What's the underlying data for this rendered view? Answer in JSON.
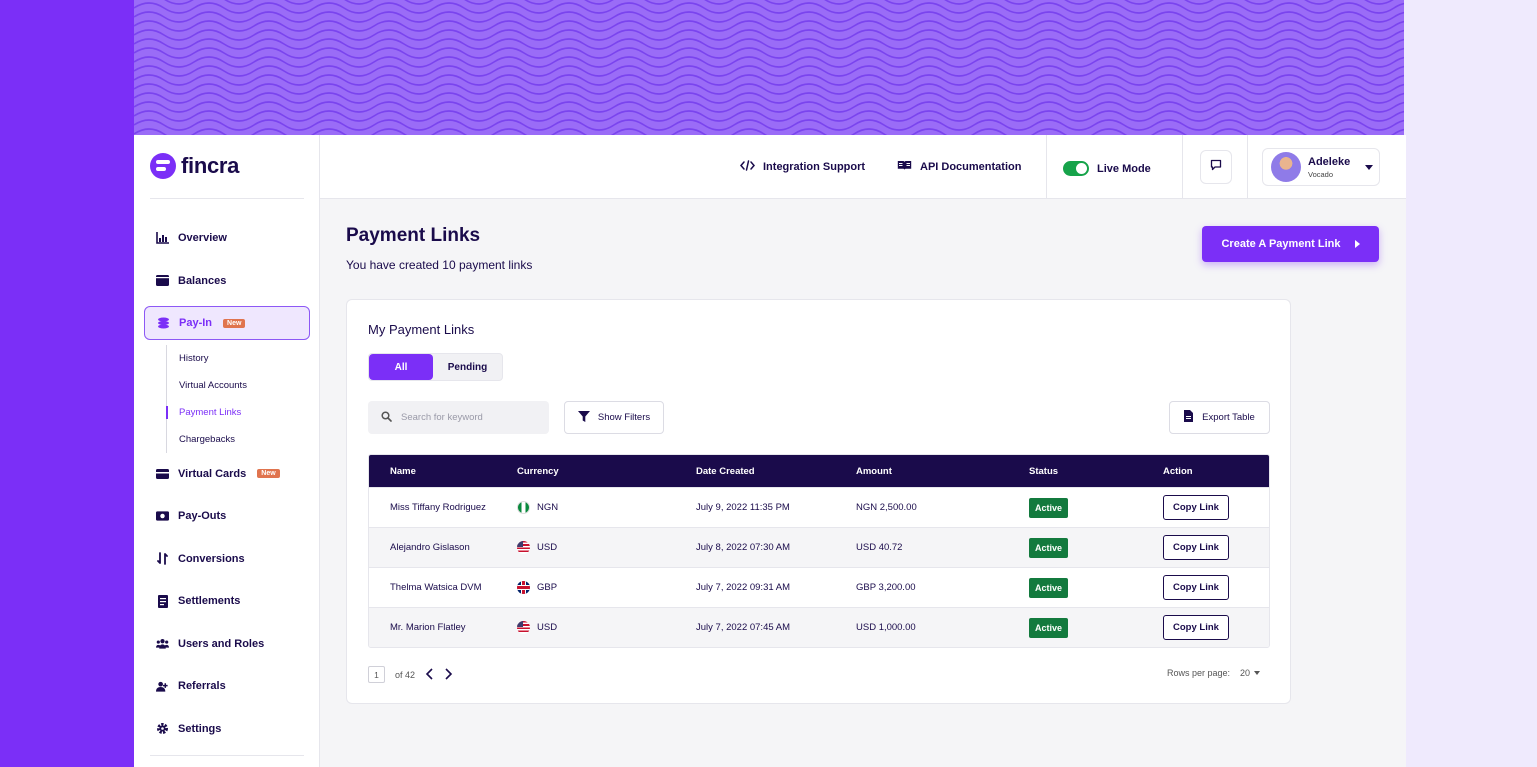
{
  "brand": {
    "name": "fincra",
    "accent": "#7b2ff7",
    "dark": "#1a0b4b",
    "success": "#137a3e",
    "badge": "#e0744e"
  },
  "sidebar": {
    "items": [
      {
        "label": "Overview",
        "icon": "chart-icon"
      },
      {
        "label": "Balances",
        "icon": "wallet-icon"
      },
      {
        "label": "Pay-In",
        "icon": "coins-icon",
        "badge": "New",
        "active": true
      },
      {
        "label": "Virtual Cards",
        "icon": "card-icon",
        "badge": "New"
      },
      {
        "label": "Pay-Outs",
        "icon": "money-icon"
      },
      {
        "label": "Conversions",
        "icon": "exchange-icon"
      },
      {
        "label": "Settlements",
        "icon": "receipt-icon"
      },
      {
        "label": "Users and Roles",
        "icon": "users-icon"
      },
      {
        "label": "Referrals",
        "icon": "referral-icon"
      },
      {
        "label": "Settings",
        "icon": "gear-icon"
      }
    ],
    "payin_sub": [
      "History",
      "Virtual Accounts",
      "Payment Links",
      "Chargebacks"
    ],
    "payin_sub_active": "Payment Links"
  },
  "header": {
    "integration_support": "Integration Support",
    "api_documentation": "API Documentation",
    "live_mode": "Live Mode",
    "user_name": "Adeleke",
    "user_company": "Vocado"
  },
  "main": {
    "title": "Payment Links",
    "subtitle": "You have created 10 payment links",
    "create_button": "Create A Payment Link",
    "card_title": "My Payment Links",
    "tabs": [
      "All",
      "Pending"
    ],
    "search_placeholder": "Search for keyword",
    "show_filters": "Show Filters",
    "export_table": "Export Table",
    "columns": [
      "Name",
      "Currency",
      "Date Created",
      "Amount",
      "Status",
      "Action"
    ],
    "rows": [
      {
        "name": "Miss Tiffany Rodriguez",
        "currency": "NGN",
        "flag": "ng",
        "date": "July 9, 2022 11:35 PM",
        "amount": "NGN 2,500.00",
        "status": "Active",
        "action": "Copy Link"
      },
      {
        "name": "Alejandro Gislason",
        "currency": "USD",
        "flag": "us",
        "date": "July 8, 2022 07:30 AM",
        "amount": "USD 40.72",
        "status": "Active",
        "action": "Copy Link"
      },
      {
        "name": "Thelma Watsica DVM",
        "currency": "GBP",
        "flag": "gb",
        "date": "July 7, 2022 09:31 AM",
        "amount": "GBP 3,200.00",
        "status": "Active",
        "action": "Copy Link"
      },
      {
        "name": "Mr. Marion Flatley",
        "currency": "USD",
        "flag": "us",
        "date": "July 7, 2022 07:45 AM",
        "amount": "USD 1,000.00",
        "status": "Active",
        "action": "Copy Link"
      }
    ],
    "pagination": {
      "page": "1",
      "of": "of 42",
      "rows_per_page_label": "Rows per page:",
      "rows_per_page": "20"
    }
  }
}
